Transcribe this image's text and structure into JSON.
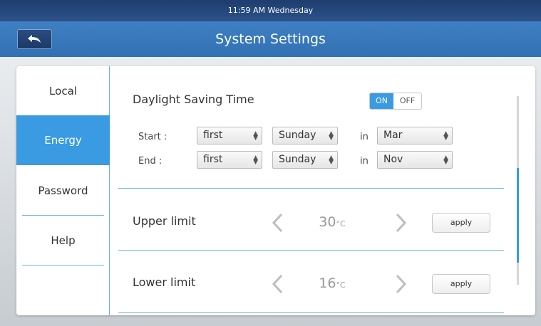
{
  "status_bar": {
    "time_text": "11:59 AM Wednesday"
  },
  "header": {
    "title": "System Settings"
  },
  "sidebar": {
    "items": [
      {
        "label": "Local"
      },
      {
        "label": "Energy",
        "active": true
      },
      {
        "label": "Password"
      },
      {
        "label": "Help"
      }
    ]
  },
  "dst": {
    "title": "Daylight Saving Time",
    "toggle": {
      "on_label": "ON",
      "off_label": "OFF",
      "state": "ON"
    },
    "start": {
      "label": "Start :",
      "week": "first",
      "day": "Sunday",
      "in_label": "in",
      "month": "Mar"
    },
    "end": {
      "label": "End :",
      "week": "first",
      "day": "Sunday",
      "in_label": "in",
      "month": "Nov"
    }
  },
  "upper_limit": {
    "label": "Upper limit",
    "value": "30",
    "unit": "°C",
    "apply_label": "apply"
  },
  "lower_limit": {
    "label": "Lower limit",
    "value": "16",
    "unit": "°C",
    "apply_label": "apply"
  },
  "colors": {
    "accent": "#3a9be2",
    "header": "#3171b3",
    "status_bar": "#1f3d6e"
  },
  "icons": {
    "back": "back-arrow-icon",
    "prev": "chevron-left-icon",
    "next": "chevron-right-icon",
    "select": "updown-arrows-icon"
  }
}
